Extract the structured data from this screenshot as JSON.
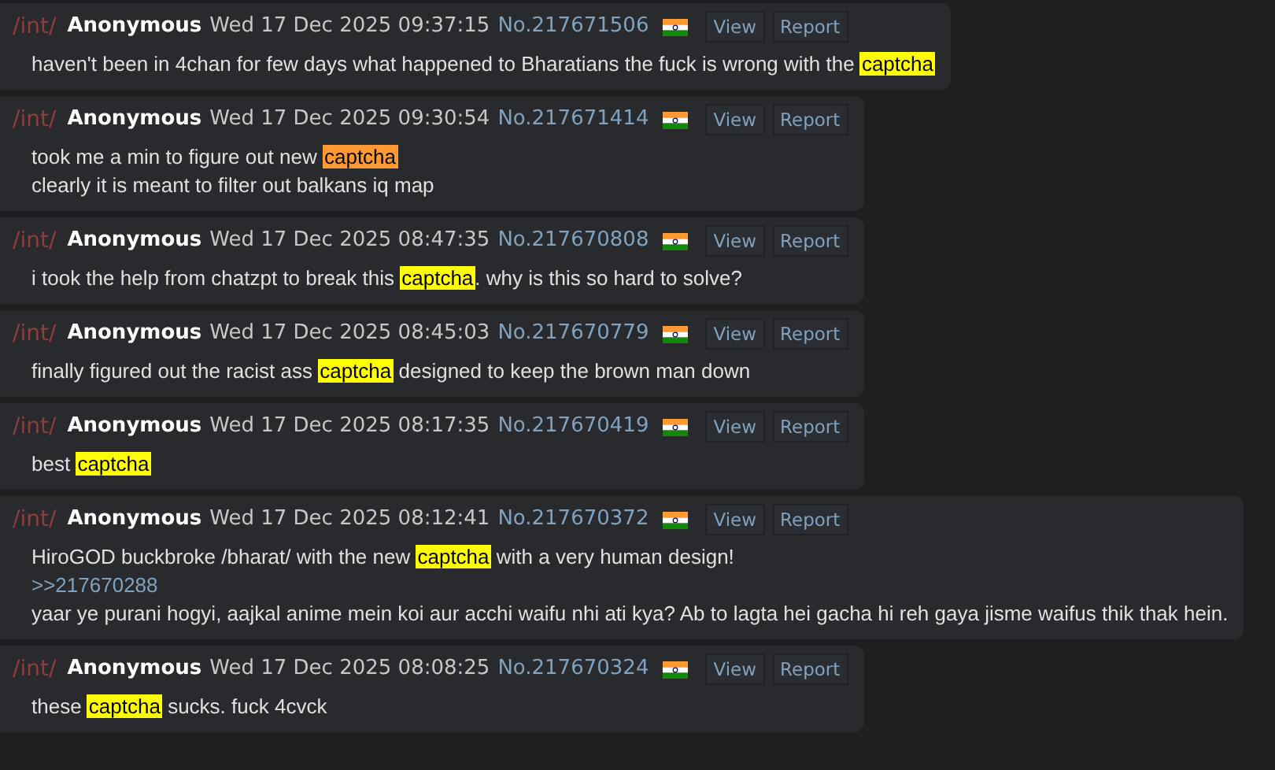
{
  "posts": [
    {
      "board": "/int/",
      "name": "Anonymous",
      "date": "Wed 17 Dec 2025 09:37:15",
      "number": "No.217671506",
      "actions": [
        "View",
        "Report"
      ],
      "lines": [
        [
          {
            "kind": "text",
            "text": "haven't been in 4chan for few days what happened to Bharatians the fuck is wrong with the "
          },
          {
            "kind": "highlight",
            "text": "captcha",
            "color": "#ffff00"
          }
        ]
      ]
    },
    {
      "board": "/int/",
      "name": "Anonymous",
      "date": "Wed 17 Dec 2025 09:30:54",
      "number": "No.217671414",
      "actions": [
        "View",
        "Report"
      ],
      "lines": [
        [
          {
            "kind": "text",
            "text": "took me a min to figure out new "
          },
          {
            "kind": "highlight",
            "text": "captcha",
            "color": "#ff9933"
          }
        ],
        [
          {
            "kind": "text",
            "text": "clearly it is meant to filter out balkans iq map"
          }
        ]
      ]
    },
    {
      "board": "/int/",
      "name": "Anonymous",
      "date": "Wed 17 Dec 2025 08:47:35",
      "number": "No.217670808",
      "actions": [
        "View",
        "Report"
      ],
      "lines": [
        [
          {
            "kind": "text",
            "text": "i took the help from chatzpt to break this "
          },
          {
            "kind": "highlight",
            "text": "captcha",
            "color": "#ffff00"
          },
          {
            "kind": "text",
            "text": ". why is this so hard to solve?"
          }
        ]
      ]
    },
    {
      "board": "/int/",
      "name": "Anonymous",
      "date": "Wed 17 Dec 2025 08:45:03",
      "number": "No.217670779",
      "actions": [
        "View",
        "Report"
      ],
      "lines": [
        [
          {
            "kind": "text",
            "text": "finally figured out the racist ass "
          },
          {
            "kind": "highlight",
            "text": "captcha",
            "color": "#ffff00"
          },
          {
            "kind": "text",
            "text": " designed to keep the brown man down"
          }
        ]
      ]
    },
    {
      "board": "/int/",
      "name": "Anonymous",
      "date": "Wed 17 Dec 2025 08:17:35",
      "number": "No.217670419",
      "actions": [
        "View",
        "Report"
      ],
      "lines": [
        [
          {
            "kind": "text",
            "text": "best "
          },
          {
            "kind": "highlight",
            "text": "captcha",
            "color": "#ffff00"
          }
        ]
      ]
    },
    {
      "board": "/int/",
      "name": "Anonymous",
      "date": "Wed 17 Dec 2025 08:12:41",
      "number": "No.217670372",
      "actions": [
        "View",
        "Report"
      ],
      "lines": [
        [
          {
            "kind": "text",
            "text": "HiroGOD buckbroke /bharat/ with the new "
          },
          {
            "kind": "highlight",
            "text": "captcha",
            "color": "#ffff00"
          },
          {
            "kind": "text",
            "text": " with a very human design!"
          }
        ],
        [
          {
            "kind": "quote",
            "text": ">>217670288"
          }
        ],
        [
          {
            "kind": "text",
            "text": "yaar ye purani hogyi, aajkal anime mein koi aur acchi waifu nhi ati kya? Ab to lagta hei gacha hi reh gaya jisme waifus thik thak hein."
          }
        ]
      ]
    },
    {
      "board": "/int/",
      "name": "Anonymous",
      "date": "Wed 17 Dec 2025 08:08:25",
      "number": "No.217670324",
      "actions": [
        "View",
        "Report"
      ],
      "lines": [
        [
          {
            "kind": "text",
            "text": "these "
          },
          {
            "kind": "highlight",
            "text": "captcha",
            "color": "#ffff00"
          },
          {
            "kind": "text",
            "text": " sucks. fuck 4cvck"
          }
        ]
      ]
    }
  ]
}
